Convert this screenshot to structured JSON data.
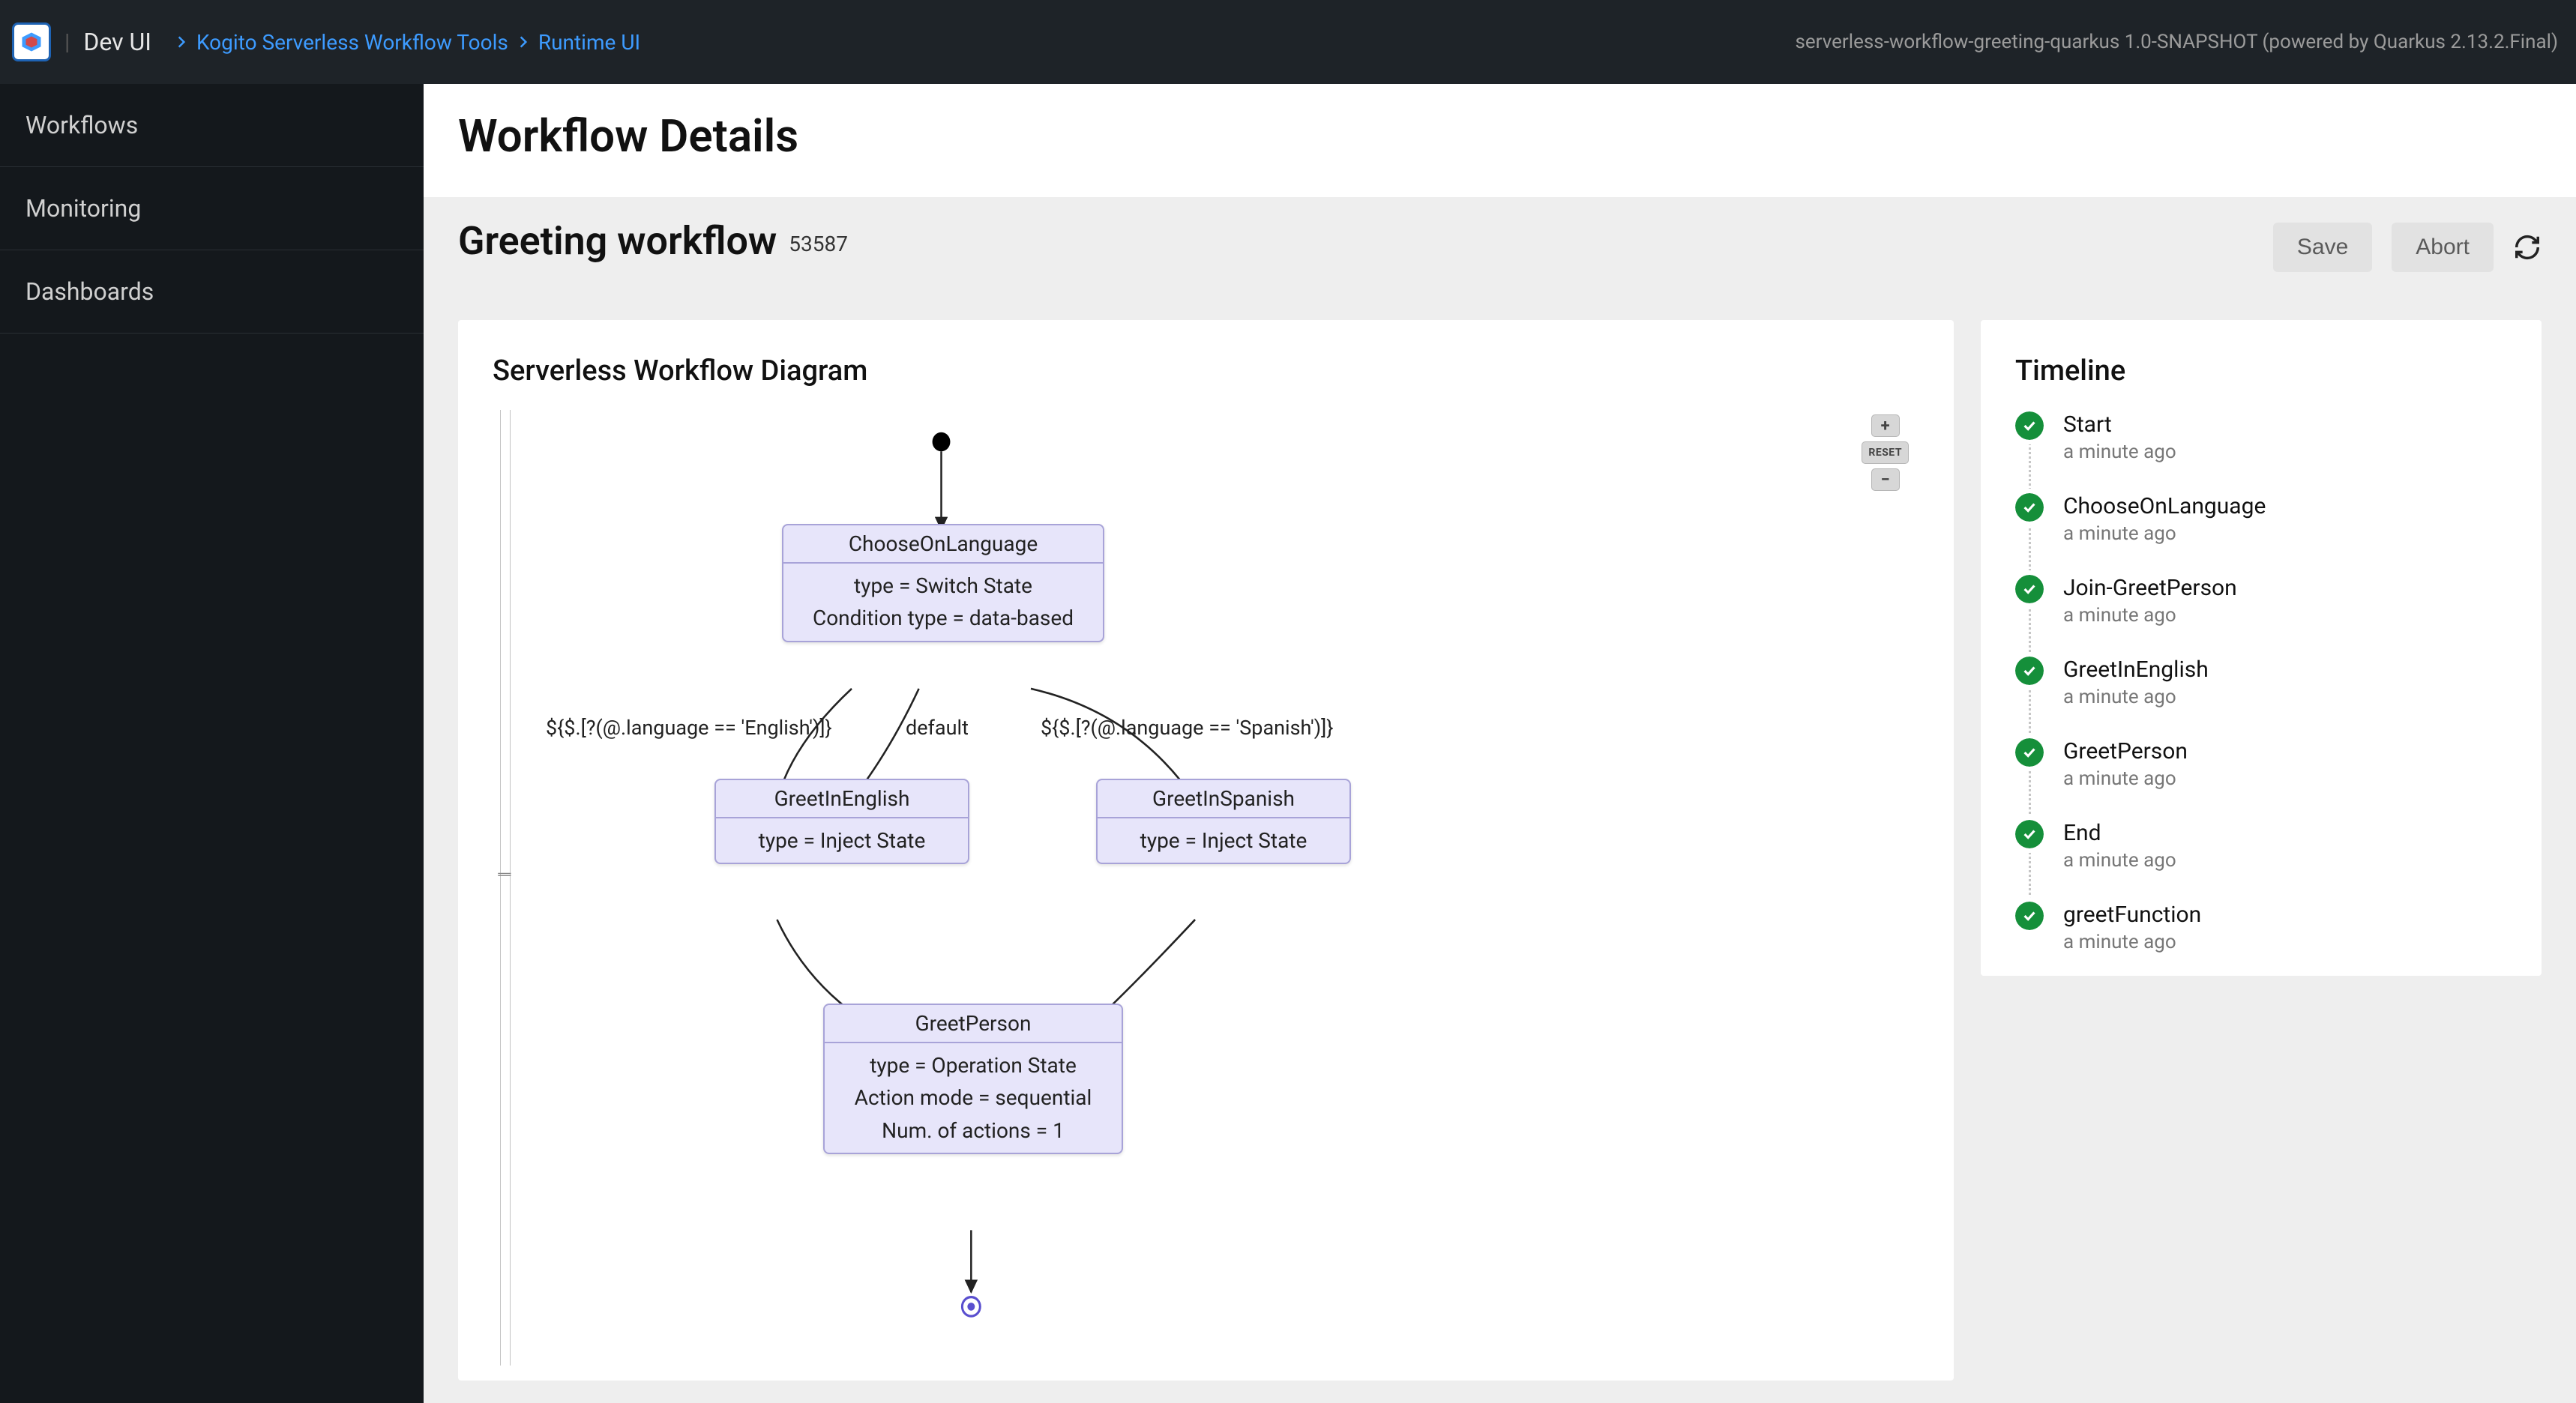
{
  "topbar": {
    "brand": "Dev UI",
    "crumb1": "Kogito Serverless Workflow Tools",
    "crumb2": "Runtime UI",
    "right": "serverless-workflow-greeting-quarkus 1.0-SNAPSHOT (powered by Quarkus 2.13.2.Final)"
  },
  "sidebar": {
    "items": [
      "Workflows",
      "Monitoring",
      "Dashboards"
    ]
  },
  "page": {
    "title": "Workflow Details",
    "workflow_name": "Greeting workflow",
    "workflow_id": "53587",
    "save_label": "Save",
    "abort_label": "Abort"
  },
  "diagram": {
    "title": "Serverless Workflow Diagram",
    "reset_label": "RESET",
    "nodes": {
      "choose": {
        "title": "ChooseOnLanguage",
        "line1": "type = Switch State",
        "line2": "Condition type = data-based"
      },
      "english": {
        "title": "GreetInEnglish",
        "line1": "type = Inject State"
      },
      "spanish": {
        "title": "GreetInSpanish",
        "line1": "type = Inject State"
      },
      "person": {
        "title": "GreetPerson",
        "line1": "type = Operation State",
        "line2": "Action mode = sequential",
        "line3": "Num. of actions = 1"
      }
    },
    "edge_labels": {
      "english_cond": "${$.[?(@.language == 'English')]}",
      "default": "default",
      "spanish_cond": "${$.[?(@.language == 'Spanish')]}"
    }
  },
  "timeline": {
    "title": "Timeline",
    "items": [
      {
        "name": "Start",
        "ago": "a minute ago"
      },
      {
        "name": "ChooseOnLanguage",
        "ago": "a minute ago"
      },
      {
        "name": "Join-GreetPerson",
        "ago": "a minute ago"
      },
      {
        "name": "GreetInEnglish",
        "ago": "a minute ago"
      },
      {
        "name": "GreetPerson",
        "ago": "a minute ago"
      },
      {
        "name": "End",
        "ago": "a minute ago"
      },
      {
        "name": "greetFunction",
        "ago": "a minute ago"
      }
    ]
  }
}
